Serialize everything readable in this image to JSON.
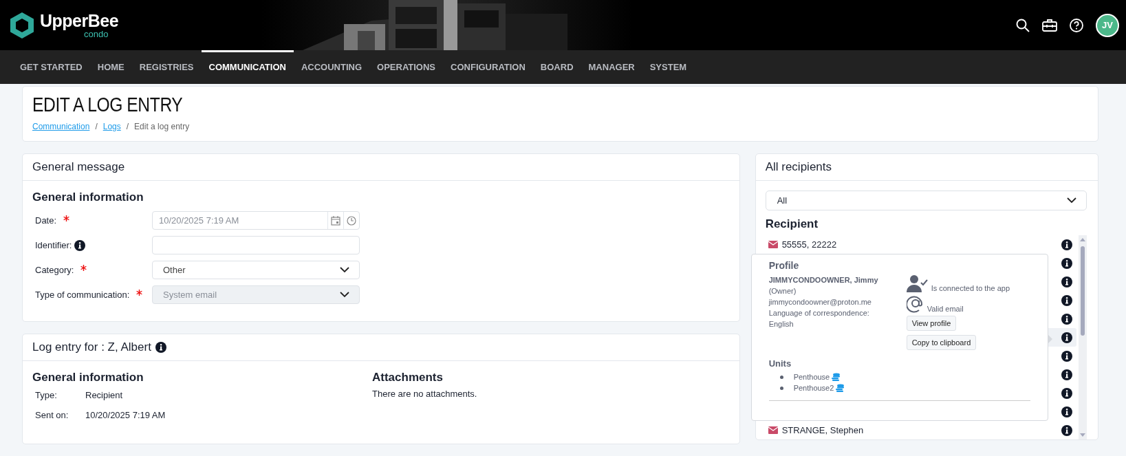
{
  "header": {
    "logo": {
      "name": "UpperBee",
      "tagline": "condo"
    },
    "avatar": "JV"
  },
  "nav": [
    {
      "label": "GET STARTED",
      "selected": false
    },
    {
      "label": "HOME",
      "selected": false
    },
    {
      "label": "REGISTRIES",
      "selected": false
    },
    {
      "label": "COMMUNICATION",
      "selected": true
    },
    {
      "label": "ACCOUNTING",
      "selected": false
    },
    {
      "label": "OPERATIONS",
      "selected": false
    },
    {
      "label": "CONFIGURATION",
      "selected": false
    },
    {
      "label": "BOARD",
      "selected": false
    },
    {
      "label": "MANAGER",
      "selected": false
    },
    {
      "label": "SYSTEM",
      "selected": false
    }
  ],
  "page": {
    "title": "EDIT A LOG ENTRY",
    "breadcrumb": [
      {
        "label": "Communication",
        "kind": "link"
      },
      {
        "label": "/",
        "kind": "separator"
      },
      {
        "label": "Logs",
        "kind": "link"
      },
      {
        "label": "/",
        "kind": "separator"
      },
      {
        "label": "Edit a log entry",
        "kind": "current"
      }
    ]
  },
  "general_message": {
    "title": "General message",
    "section": "General information",
    "fields": [
      {
        "label": "Date:",
        "kind": "datetime",
        "required": true,
        "info": false,
        "disabled": false,
        "value": "10/20/2025 7:19 AM"
      },
      {
        "label": "Identifier:",
        "kind": "text",
        "required": false,
        "info": true,
        "disabled": false
      },
      {
        "label": "Category:",
        "kind": "select",
        "required": true,
        "info": false,
        "disabled": false,
        "value": "Other"
      },
      {
        "label": "Type of communication:",
        "kind": "select",
        "required": true,
        "info": false,
        "disabled": true,
        "value": "System email"
      }
    ]
  },
  "log_entry": {
    "title": "Log entry for : Z, Albert",
    "section": "General information",
    "details": [
      {
        "label": "Type:",
        "value": "Recipient"
      },
      {
        "label": "Sent on:",
        "value": "10/20/2025 7:19 AM"
      }
    ],
    "attachments": {
      "title": "Attachments",
      "text": "There are no attachments."
    }
  },
  "recipients_panel": {
    "title": "All recipients",
    "filter": "All",
    "list_title": "Recipient",
    "recipients": [
      {
        "name": "55555, 22222",
        "selected": false
      },
      {
        "selected": false
      },
      {
        "selected": false
      },
      {
        "selected": false
      },
      {
        "selected": false
      },
      {
        "selected": true
      },
      {
        "selected": false
      },
      {
        "selected": false
      },
      {
        "selected": false
      },
      {
        "selected": false
      },
      {
        "name": "STRANGE, Stephen",
        "selected": false
      }
    ],
    "popup": {
      "title": "Profile",
      "name": "JIMMYCONDOOWNER, Jimmy",
      "role": "(Owner)",
      "email": "jimmycondoowner@proton.me",
      "language_label": "Language of correspondence:",
      "language": "English",
      "statuses": [
        {
          "kind": "app",
          "text": "Is connected to the app"
        },
        {
          "kind": "email",
          "text": "Valid email"
        }
      ],
      "buttons": [
        "View profile",
        "Copy to clipboard"
      ],
      "units_title": "Units",
      "units": [
        "Penthouse",
        "Penthouse2"
      ]
    }
  }
}
